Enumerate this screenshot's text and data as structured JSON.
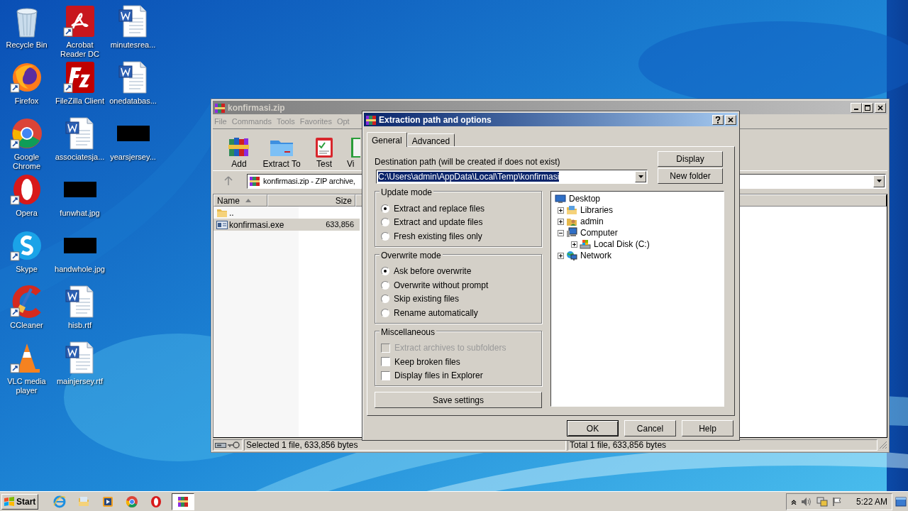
{
  "desktop_icons": [
    {
      "label": "Recycle Bin",
      "kind": "bin"
    },
    {
      "label": "Firefox",
      "kind": "app"
    },
    {
      "label": "Google Chrome",
      "kind": "app"
    },
    {
      "label": "Opera",
      "kind": "app"
    },
    {
      "label": "Skype",
      "kind": "app"
    },
    {
      "label": "CCleaner",
      "kind": "app"
    },
    {
      "label": "VLC media player",
      "kind": "app"
    },
    {
      "label": "Acrobat Reader DC",
      "kind": "app"
    },
    {
      "label": "FileZilla Client",
      "kind": "app"
    },
    {
      "label": "associatesja...",
      "kind": "document"
    },
    {
      "label": "funwhat.jpg"
    },
    {
      "label": "handwhole.jpg"
    },
    {
      "label": "hisb.rtf",
      "kind": "document"
    },
    {
      "label": "mainjersey.rtf",
      "kind": "document"
    },
    {
      "label": "minutesrea...",
      "kind": "document"
    },
    {
      "label": "onedatabas...",
      "kind": "document"
    },
    {
      "label": "yearsjersey..."
    }
  ],
  "archiver_window": {
    "title": "konfirmasi.zip",
    "menu": [
      "File",
      "Commands",
      "Tools",
      "Favorites",
      "Opt"
    ],
    "toolbar": [
      "Add",
      "Extract To",
      "Test",
      "Vi"
    ],
    "address": "konfirmasi.zip - ZIP archive,",
    "columns": [
      {
        "label": "Name",
        "sorted": true
      },
      {
        "label": "Size",
        "sorted": false
      }
    ],
    "files": [
      {
        "name": "..",
        "kind": "folder",
        "selected": false
      },
      {
        "name": "konfirmasi.exe",
        "kind": "file",
        "size": "633,856",
        "selected": true
      }
    ],
    "status_left": "Selected 1 file, 633,856 bytes",
    "status_right": "Total 1 file, 633,856 bytes"
  },
  "dialog": {
    "title": "Extraction path and options",
    "tabs": [
      {
        "label": "General",
        "selected": true
      },
      {
        "label": "Advanced",
        "selected": false
      }
    ],
    "destination_label": "Destination path (will be created if does not exist)",
    "destination_path": "C:\\Users\\admin\\AppData\\Local\\Temp\\konfirmasi",
    "side_buttons": [
      "Display",
      "New folder"
    ],
    "groups": [
      {
        "title": "Update mode",
        "options": [
          {
            "label": "Extract and replace files",
            "kind": "radio",
            "checked": true,
            "disabled": false
          },
          {
            "label": "Extract and update files",
            "kind": "radio",
            "checked": false,
            "disabled": false
          },
          {
            "label": "Fresh existing files only",
            "kind": "radio",
            "checked": false,
            "disabled": false
          }
        ]
      },
      {
        "title": "Overwrite mode",
        "options": [
          {
            "label": "Ask before overwrite",
            "kind": "radio",
            "checked": true,
            "disabled": false
          },
          {
            "label": "Overwrite without prompt",
            "kind": "radio",
            "checked": false,
            "disabled": false
          },
          {
            "label": "Skip existing files",
            "kind": "radio",
            "checked": false,
            "disabled": false
          },
          {
            "label": "Rename automatically",
            "kind": "radio",
            "checked": false,
            "disabled": false
          }
        ]
      },
      {
        "title": "Miscellaneous",
        "options": [
          {
            "label": "Extract archives to subfolders",
            "kind": "checkbox",
            "checked": false,
            "disabled": true
          },
          {
            "label": "Keep broken files",
            "kind": "checkbox",
            "checked": false,
            "disabled": false
          },
          {
            "label": "Display files in Explorer",
            "kind": "checkbox",
            "checked": false,
            "disabled": false
          }
        ]
      }
    ],
    "save_button": "Save settings",
    "tree": {
      "label": "Desktop",
      "children": [
        {
          "label": "Libraries",
          "kind": "libraries",
          "expanded": false
        },
        {
          "label": "admin",
          "kind": "user",
          "expanded": false
        },
        {
          "label": "Computer",
          "kind": "computer",
          "expanded": true,
          "children": [
            {
              "label": "Local Disk (C:)",
              "kind": "disk",
              "expanded": false
            }
          ]
        },
        {
          "label": "Network",
          "kind": "network",
          "expanded": false
        }
      ]
    },
    "buttons": [
      {
        "label": "OK",
        "default": true
      },
      {
        "label": "Cancel",
        "default": false
      },
      {
        "label": "Help",
        "default": false
      }
    ]
  },
  "taskbar": {
    "start": "Start",
    "apps": [
      {
        "selected": false
      },
      {
        "selected": false
      },
      {
        "selected": false
      },
      {
        "selected": false
      },
      {
        "selected": false
      },
      {
        "selected": true
      }
    ],
    "clock": "5:22 AM"
  }
}
